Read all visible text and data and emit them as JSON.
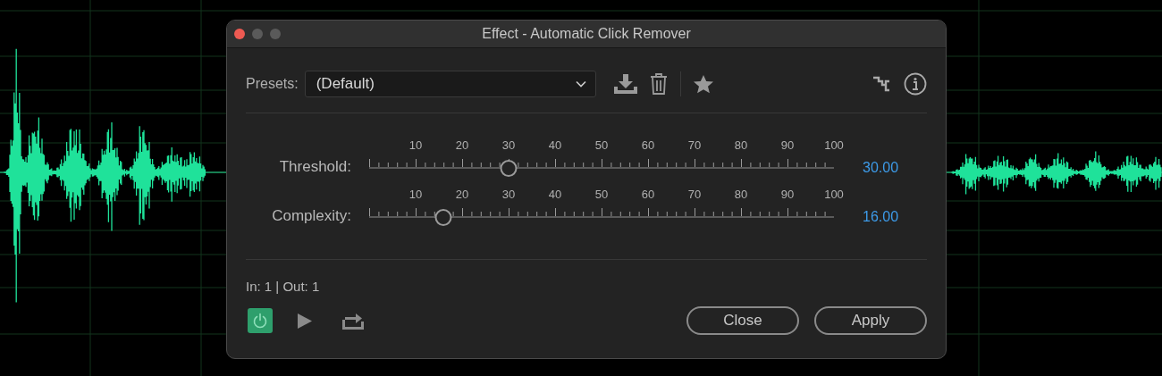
{
  "window": {
    "title": "Effect - Automatic Click Remover"
  },
  "presets": {
    "label": "Presets:",
    "value": "(Default)"
  },
  "sliders": [
    {
      "label": "Threshold:",
      "level": 0.3,
      "reading": "30.00",
      "ticks": [
        "10",
        "20",
        "30",
        "40",
        "50",
        "60",
        "70",
        "80",
        "90",
        "100"
      ]
    },
    {
      "label": "Complexity:",
      "level": 0.16,
      "reading": "16.00",
      "ticks": [
        "10",
        "20",
        "30",
        "40",
        "50",
        "60",
        "70",
        "80",
        "90",
        "100"
      ]
    }
  ],
  "channels": "In: 1 | Out: 1",
  "power": {
    "on": true
  },
  "buttons": [
    "Close",
    "Apply"
  ]
}
